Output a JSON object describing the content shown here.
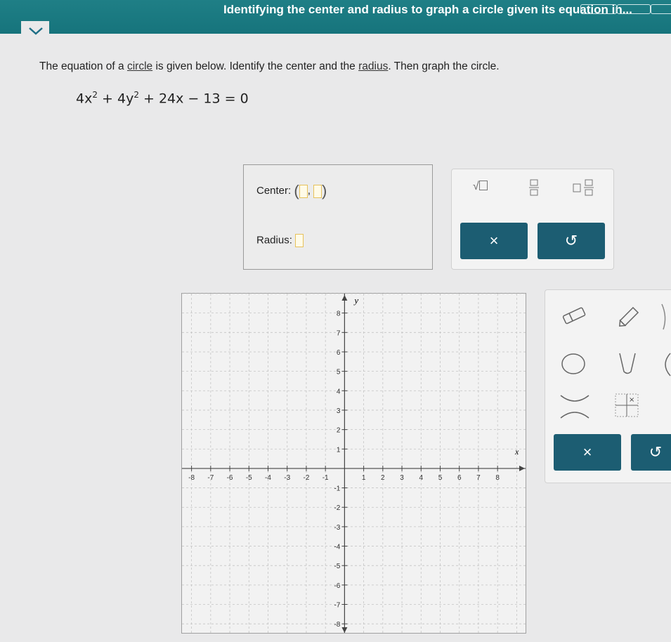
{
  "header": {
    "title": "Identifying the center and radius to graph a circle given its equation in..."
  },
  "problem": {
    "prompt_pre": "The equation of a ",
    "link1": "circle",
    "prompt_mid": " is given below. Identify the center and the ",
    "link2": "radius",
    "prompt_post": ". Then graph the circle.",
    "equation": {
      "t1": "4x",
      "e1": "2",
      "t2": " + 4y",
      "e2": "2",
      "t3": " + 24x − 13 = 0"
    }
  },
  "answer": {
    "center_label": "Center:",
    "center_comma": ",",
    "radius_label": "Radius:"
  },
  "keypad": {
    "sqrt_symbol": "√",
    "clear_symbol": "×",
    "undo_symbol": "↺"
  },
  "graph": {
    "x_label": "x",
    "y_label": "y",
    "x_ticks": [
      "-8",
      "-7",
      "-6",
      "-5",
      "-4",
      "-3",
      "-2",
      "-1",
      "1",
      "2",
      "3",
      "4",
      "5",
      "6",
      "7",
      "8"
    ],
    "y_ticks": [
      "8",
      "7",
      "6",
      "5",
      "4",
      "3",
      "2",
      "1",
      "-1",
      "-2",
      "-3",
      "-4",
      "-5",
      "-6",
      "-7",
      "-8"
    ],
    "xlim": [
      -8.5,
      9.5
    ],
    "ylim": [
      -8.5,
      9
    ]
  },
  "draw_tools": {
    "clear_symbol": "×",
    "undo_symbol": "↺"
  },
  "colors": {
    "header": "#16747c",
    "button": "#1c5d72",
    "slot_border": "#e7c25a"
  }
}
